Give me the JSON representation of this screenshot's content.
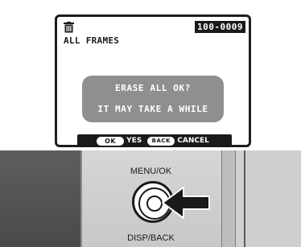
{
  "lcd": {
    "icon": "trash-icon",
    "frame_number": "100-0009",
    "mode_label": "ALL FRAMES",
    "dialog": {
      "line1": "ERASE ALL OK?",
      "line2": "IT MAY TAKE A WHILE"
    },
    "button_guide": {
      "ok_key": "OK",
      "ok_action": "YES",
      "back_key": "BACK",
      "back_action": "CANCEL"
    }
  },
  "camera": {
    "menu_ok_label": "MENU/OK",
    "disp_back_label": "DISP/BACK",
    "arrow_icon": "arrow-left-icon"
  },
  "colors": {
    "lcd_border": "#1e1e1e",
    "dialog_background": "#8f8f8f",
    "guide_bar": "#1a1a1a",
    "camera_body": "#c9c9c9",
    "camera_dark": "#4a4a4a"
  }
}
